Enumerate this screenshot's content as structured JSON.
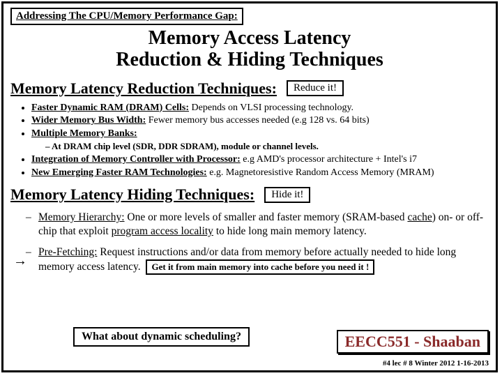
{
  "topbox": "Addressing The CPU/Memory Performance Gap:",
  "title_l1": "Memory Access Latency",
  "title_l2": "Reduction & Hiding Techniques",
  "sect1": "Memory Latency Reduction Techniques:",
  "badge1": "Reduce it!",
  "b1_u": "Faster Dynamic RAM (DRAM) Cells:",
  "b1_n": "  Depends on VLSI processing technology.",
  "b2_u": "Wider Memory Bus Width:",
  "b2_n": " Fewer memory bus accesses needed  (e.g 128 vs. 64 bits)",
  "b3_u": "Multiple Memory Banks:",
  "sub1": "At DRAM chip level (SDR, DDR SDRAM), module or channel levels.",
  "b4_u": "Integration of Memory Controller with Processor:",
  "b4_n": "  e.g AMD's processor architecture + Intel's i7",
  "b5_u": "New Emerging Faster RAM Technologies:",
  "b5_n": "   e.g. Magnetoresistive Random Access Memory (MRAM)",
  "sect2": "Memory Latency Hiding Techniques:",
  "badge2": "Hide it!",
  "h1_a": "Memory Hierarchy:",
  "h1_b": " One or more levels of smaller and faster memory (SRAM-based ",
  "h1_c": "cache",
  "h1_d": ") on- or off-chip that exploit ",
  "h1_e": "program access locality",
  "h1_f": " to hide long main memory latency.",
  "h2_a": "Pre-Fetching:",
  "h2_b": "  Request instructions and/or data from memory before actually needed to hide long memory access latency.",
  "getbox": "Get it from main memory into cache before you need it !",
  "qbox": "What about dynamic scheduling?",
  "course": "EECC551 - Shaaban",
  "footer": "#4  lec # 8   Winter 2012  1-16-2013"
}
